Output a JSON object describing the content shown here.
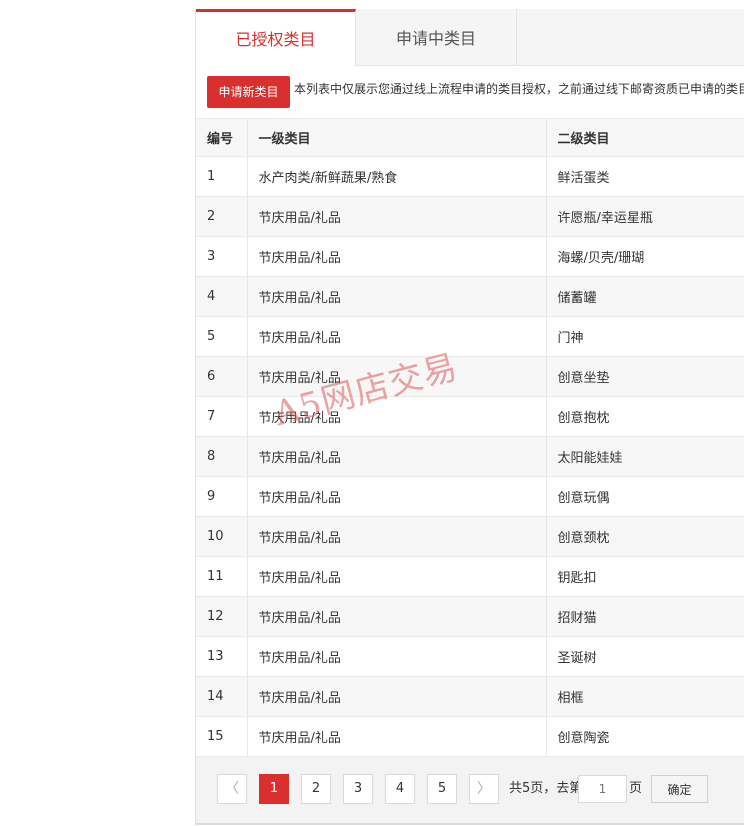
{
  "tabs": [
    {
      "label": "已授权类目",
      "active": true
    },
    {
      "label": "申请中类目",
      "active": false
    }
  ],
  "toolbar": {
    "apply_label": "申请新类目",
    "notice": "本列表中仅展示您通过线上流程申请的类目授权，之前通过线下邮寄资质已申请的类目"
  },
  "table": {
    "headers": [
      "编号",
      "一级类目",
      "二级类目"
    ],
    "rows": [
      [
        "1",
        "水产肉类/新鲜蔬果/熟食",
        "鲜活蛋类"
      ],
      [
        "2",
        "节庆用品/礼品",
        "许愿瓶/幸运星瓶"
      ],
      [
        "3",
        "节庆用品/礼品",
        "海螺/贝壳/珊瑚"
      ],
      [
        "4",
        "节庆用品/礼品",
        "储蓄罐"
      ],
      [
        "5",
        "节庆用品/礼品",
        "门神"
      ],
      [
        "6",
        "节庆用品/礼品",
        "创意坐垫"
      ],
      [
        "7",
        "节庆用品/礼品",
        "创意抱枕"
      ],
      [
        "8",
        "节庆用品/礼品",
        "太阳能娃娃"
      ],
      [
        "9",
        "节庆用品/礼品",
        "创意玩偶"
      ],
      [
        "10",
        "节庆用品/礼品",
        "创意颈枕"
      ],
      [
        "11",
        "节庆用品/礼品",
        "钥匙扣"
      ],
      [
        "12",
        "节庆用品/礼品",
        "招财猫"
      ],
      [
        "13",
        "节庆用品/礼品",
        "圣诞树"
      ],
      [
        "14",
        "节庆用品/礼品",
        "相框"
      ],
      [
        "15",
        "节庆用品/礼品",
        "创意陶瓷"
      ]
    ]
  },
  "pager": {
    "prev": "〈",
    "next": "〉",
    "pages": [
      "1",
      "2",
      "3",
      "4",
      "5"
    ],
    "current_page": 1,
    "total_text": "共5页，去第",
    "page_unit": "页",
    "input_placeholder": "1",
    "confirm_label": "确定"
  },
  "watermark": "A5网店交易",
  "colors": {
    "accent": "#d9302f",
    "row_alt": "#f7f7f7",
    "border": "#e6e6e6"
  }
}
